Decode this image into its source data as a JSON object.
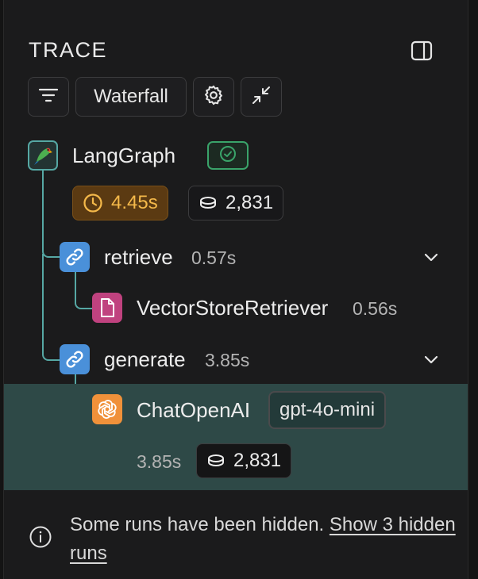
{
  "panel": {
    "title": "TRACE",
    "toolbar": {
      "view_mode_label": "Waterfall"
    }
  },
  "tree": {
    "root": {
      "label": "LangGraph",
      "status": "success",
      "duration": "4.45s",
      "tokens": "2,831"
    },
    "retrieve": {
      "label": "retrieve",
      "duration": "0.57s"
    },
    "vector_store": {
      "label": "VectorStoreRetriever",
      "duration": "0.56s"
    },
    "generate": {
      "label": "generate",
      "duration": "3.85s"
    },
    "chat": {
      "label": "ChatOpenAI",
      "model": "gpt-4o-mini",
      "duration": "3.85s",
      "tokens": "2,831"
    }
  },
  "notice": {
    "text": "Some runs have been hidden.",
    "link": "Show 3 hidden runs"
  },
  "colors": {
    "accent_teal": "#56a8a4",
    "selected_row": "#2e4947",
    "duration_badge_bg": "#5b3a12",
    "duration_badge_text": "#f5b94a",
    "success_green": "#3aa36a",
    "chain_blue": "#4a90d9",
    "retriever_pink": "#c0427f",
    "llm_orange": "#f0913a"
  },
  "icons": {
    "filter": "filter-icon",
    "settings": "gear-icon",
    "collapse": "collapse-arrows-icon",
    "panel": "panel-toggle-icon",
    "root": "parrot-icon",
    "chain": "link-icon",
    "retriever": "document-icon",
    "llm": "openai-icon",
    "tokens": "coins-icon",
    "clock": "clock-icon",
    "info": "info-icon"
  }
}
